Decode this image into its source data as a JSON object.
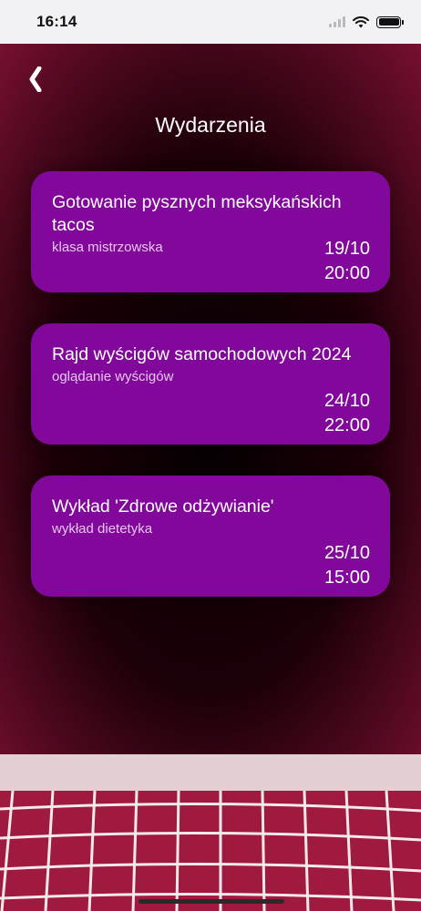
{
  "status_bar": {
    "time": "16:14"
  },
  "header": {
    "title": "Wydarzenia"
  },
  "events": [
    {
      "title": "Gotowanie pysznych meksykańskich tacos",
      "subtitle": "klasa mistrzowska",
      "date": "19/10",
      "time": "20:00"
    },
    {
      "title": "Rajd wyścigów samochodowych 2024",
      "subtitle": "oglądanie wyścigów",
      "date": "24/10",
      "time": "22:00"
    },
    {
      "title": "Wykład 'Zdrowe odżywianie'",
      "subtitle": "wykład dietetyka",
      "date": "25/10",
      "time": "15:00"
    }
  ],
  "colors": {
    "card": "#81089a",
    "background_edge": "#b51f48",
    "background_center": "#050002"
  },
  "icons": {
    "back": "chevron-left-icon",
    "wifi": "wifi-icon",
    "battery": "battery-icon",
    "signal": "signal-icon"
  }
}
